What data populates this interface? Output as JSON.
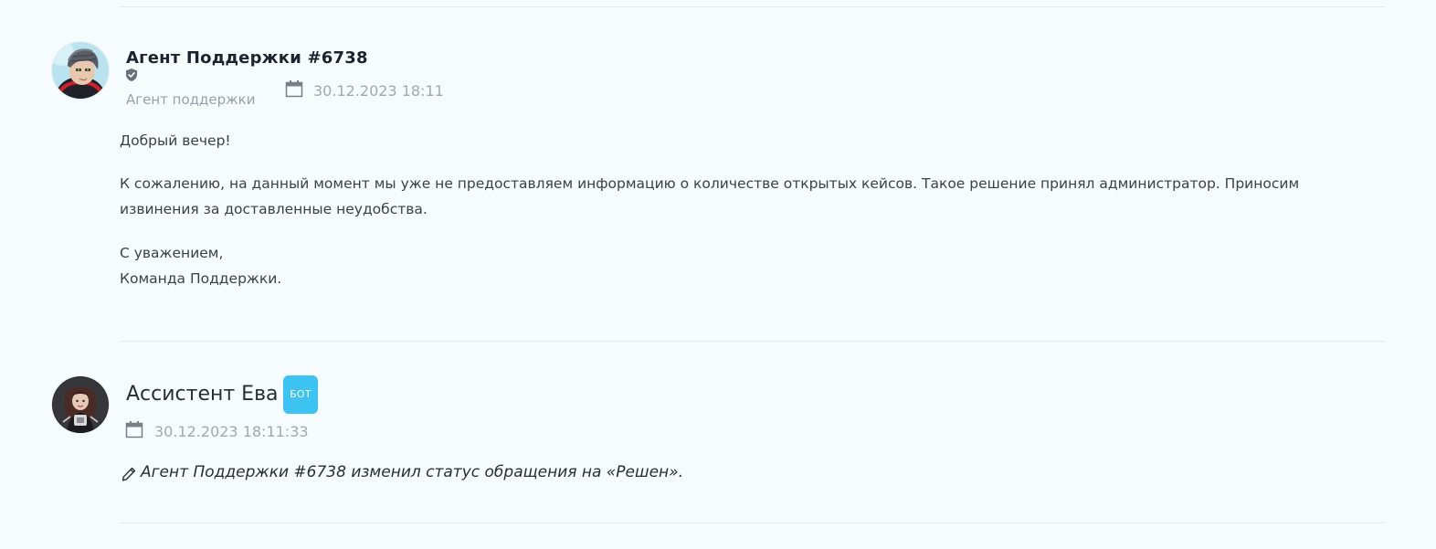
{
  "messages": [
    {
      "author": "Агент Поддержки #6738",
      "role": "Агент поддержки",
      "role_icon": "shield-check-icon",
      "avatar": "agent-avatar",
      "datetime": "30.12.2023 18:11",
      "date_icon": "calendar-icon",
      "body": {
        "greeting": "Добрый вечер!",
        "line1": "К сожалению, на данный момент мы уже не предоставляем информацию о количестве открытых кейсов. Такое решение принял администратор. Приносим",
        "line2": "извинения за доставленные неудобства.",
        "signoff1": "С уважением,",
        "signoff2": "Команда Поддержки."
      }
    },
    {
      "author": "Ассистент Ева",
      "badge": "БОТ",
      "avatar": "assistant-avatar",
      "datetime": "30.12.2023 18:11:33",
      "date_icon": "calendar-icon",
      "status_icon": "pencil-icon",
      "status_text": "Агент Поддержки #6738 изменил статус обращения на «Решен»."
    }
  ],
  "colors": {
    "background": "#f6fbfd",
    "divider": "#e4e9ee",
    "badge": "#3cc3f2",
    "muted_text": "#9aa0ab"
  }
}
